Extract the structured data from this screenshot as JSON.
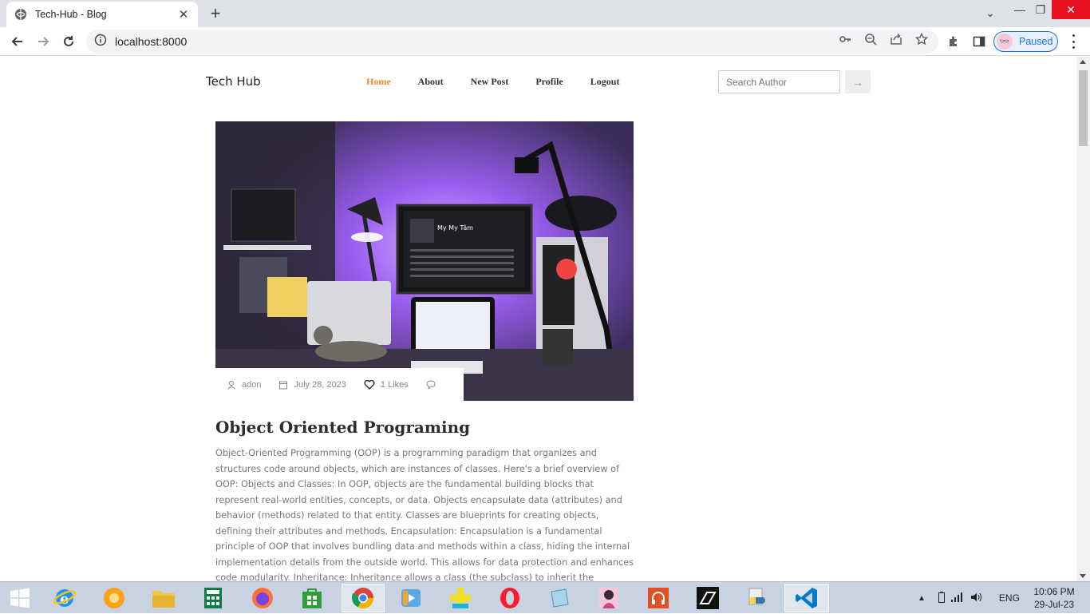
{
  "browser": {
    "tab_title": "Tech-Hub - Blog",
    "url": "localhost:8000",
    "profile_status": "Paused"
  },
  "site": {
    "brand": "Tech Hub",
    "nav": [
      {
        "label": "Home",
        "active": true
      },
      {
        "label": "About",
        "active": false
      },
      {
        "label": "New Post",
        "active": false
      },
      {
        "label": "Profile",
        "active": false
      },
      {
        "label": "Logout",
        "active": false
      }
    ],
    "search_placeholder": "Search Author",
    "search_button_icon": "arrow-right-icon",
    "accent_color": "#f18d2d"
  },
  "post": {
    "author": "adon",
    "date": "July 28, 2023",
    "likes": "1 Likes",
    "title": "Object Oriented Programing",
    "body": "Object-Oriented Programming (OOP) is a programming paradigm that organizes and structures code around objects, which are instances of classes. Here's a brief overview of OOP: Objects and Classes: In OOP, objects are the fundamental building blocks that represent real-world entities, concepts, or data. Objects encapsulate data (attributes) and behavior (methods) related to that entity. Classes are blueprints for creating objects, defining their attributes and methods. Encapsulation: Encapsulation is a fundamental principle of OOP that involves bundling data and methods within a class, hiding the internal implementation details from the outside world. This allows for data protection and enhances code modularity. Inheritance: Inheritance allows a class (the subclass) to inherit the properties and behaviors of another class (the superclass). It promotes code reuse and hierarchical organization, with subclasses"
  },
  "taskbar": {
    "language": "ENG",
    "time": "10:06 PM",
    "date": "29-Jul-23",
    "apps": [
      "start-icon",
      "internet-explorer-icon",
      "media-player-icon",
      "file-explorer-icon",
      "calculator-icon",
      "firefox-icon",
      "store-icon",
      "chrome-icon",
      "video-player-icon",
      "game-icon",
      "opera-icon",
      "notes-icon",
      "anime-app-icon",
      "headphones-icon",
      "need-for-speed-icon",
      "python-icon",
      "vscode-icon"
    ]
  }
}
